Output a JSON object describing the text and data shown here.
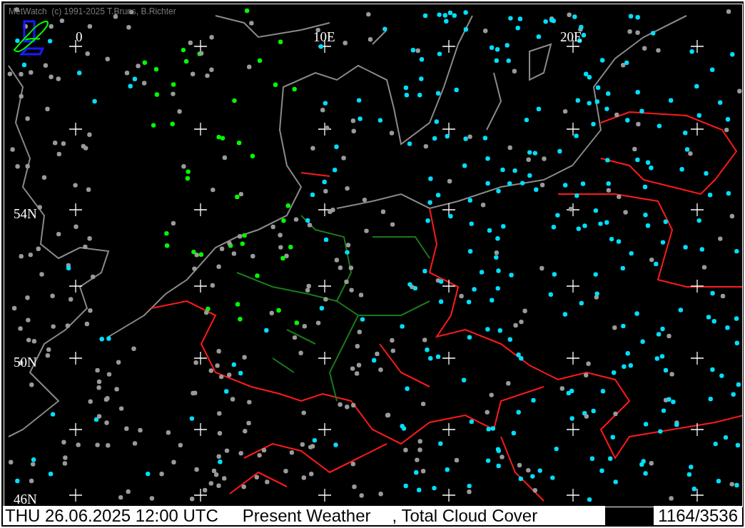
{
  "header": {
    "copyright": "MetWatch  (c) 1991-2025 T.Bruns, B.Richter"
  },
  "map": {
    "longitude_labels": [
      "0",
      "10E",
      "20E"
    ],
    "latitude_labels": [
      "54N",
      "50N",
      "46N"
    ]
  },
  "status_bar": {
    "datetime": "THU 26.06.2025 12:00 UTC",
    "parameter_1": "Present Weather",
    "parameter_2": ", Total Cloud Cover",
    "station_count": "1164/3536"
  }
}
